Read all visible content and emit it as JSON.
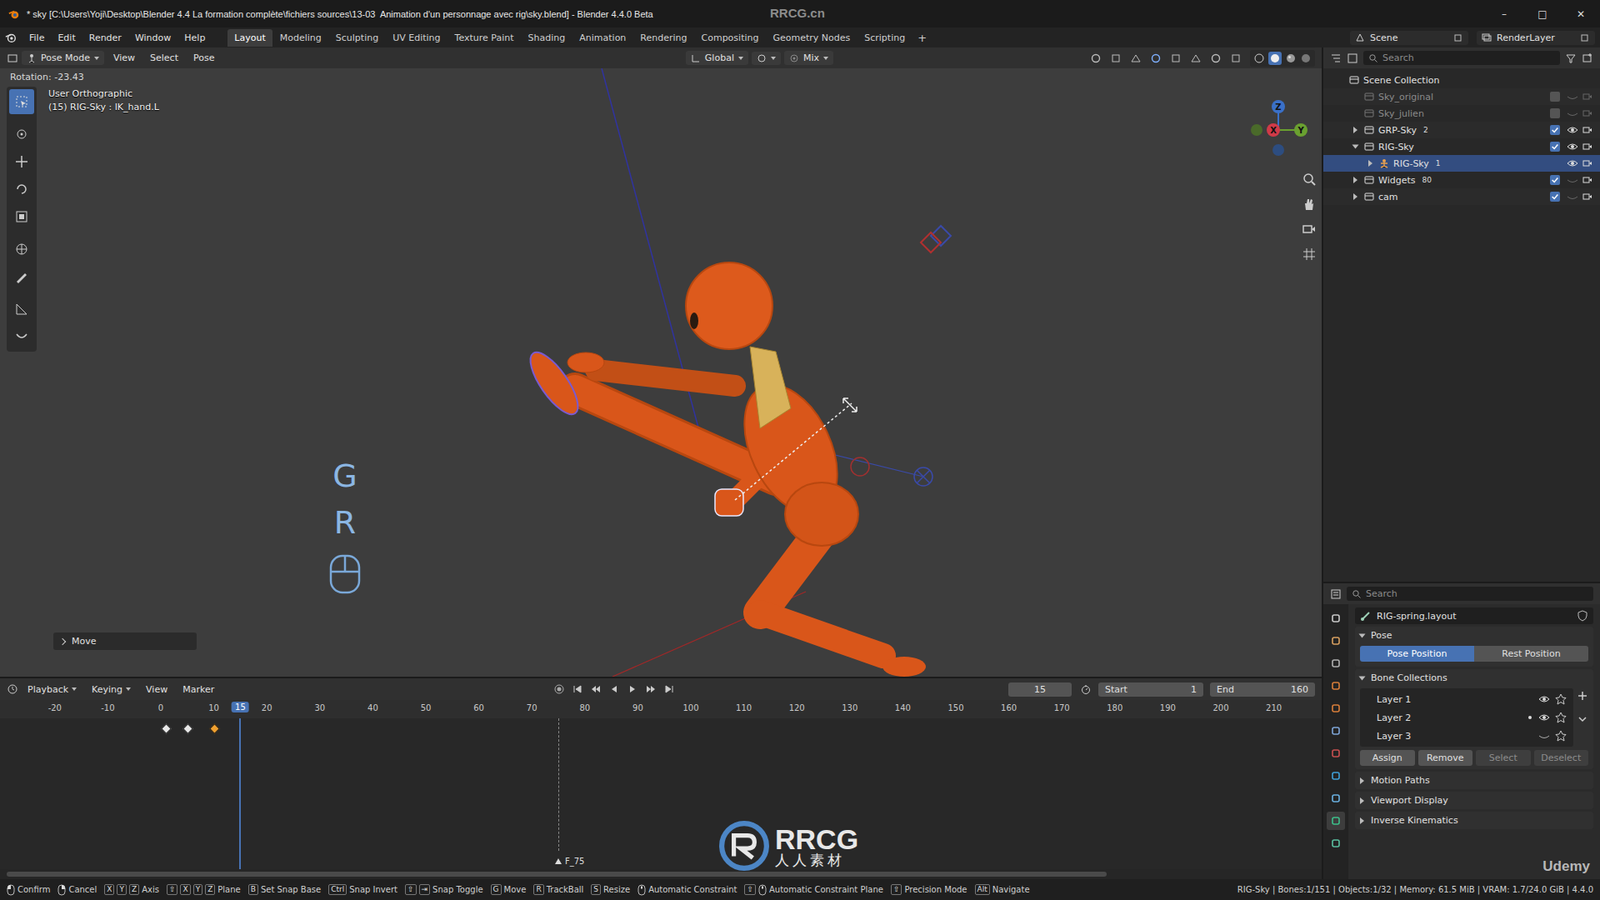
{
  "window": {
    "title": "* sky [C:\\Users\\Yoji\\Desktop\\Blender 4.4 La formation complète\\fichiers sources\\13-03  Animation d'un personnage avec rig\\sky.blend] - Blender 4.4.0 Beta",
    "controls": [
      "–",
      "□",
      "✕"
    ]
  },
  "watermarks": {
    "top": "RRCG.cn",
    "logo": "RRCG",
    "logo_sub": "人人素材",
    "corner": "Udemy"
  },
  "menu": [
    "File",
    "Edit",
    "Render",
    "Window",
    "Help"
  ],
  "workspaces": [
    {
      "label": "Layout",
      "selected": true
    },
    {
      "label": "Modeling",
      "selected": false
    },
    {
      "label": "Sculpting",
      "selected": false
    },
    {
      "label": "UV Editing",
      "selected": false
    },
    {
      "label": "Texture Paint",
      "selected": false
    },
    {
      "label": "Shading",
      "selected": false
    },
    {
      "label": "Animation",
      "selected": false
    },
    {
      "label": "Rendering",
      "selected": false
    },
    {
      "label": "Compositing",
      "selected": false
    },
    {
      "label": "Geometry Nodes",
      "selected": false
    },
    {
      "label": "Scripting",
      "selected": false
    }
  ],
  "workspace_add": "+",
  "scene": "Scene",
  "view_layer": "RenderLayer",
  "viewport": {
    "mode": "Pose Mode",
    "menus": [
      "View",
      "Select",
      "Pose"
    ],
    "orientation": "Global",
    "pivot": "Mix",
    "status": "Rotation: -23.43",
    "view_name": "User Orthographic",
    "active": "(15) RIG-Sky : IK_hand.L",
    "keys": [
      "G",
      "R"
    ],
    "operator": "Move",
    "gizmo": {
      "x": "X",
      "y": "Y",
      "z": "Z"
    }
  },
  "outliner": {
    "search": "Search",
    "items": [
      {
        "name": "Scene Collection",
        "kind": "scene",
        "depth": 0,
        "expandable": false,
        "expanded": false,
        "included": true,
        "visible": true,
        "selected": false,
        "badge": ""
      },
      {
        "name": "Sky_original",
        "kind": "collection",
        "depth": 1,
        "expandable": false,
        "expanded": false,
        "included": false,
        "visible": false,
        "selected": false,
        "badge": ""
      },
      {
        "name": "Sky_julien",
        "kind": "collection",
        "depth": 1,
        "expandable": false,
        "expanded": false,
        "included": false,
        "visible": false,
        "selected": false,
        "badge": ""
      },
      {
        "name": "GRP-Sky",
        "kind": "collection",
        "depth": 1,
        "expandable": true,
        "expanded": false,
        "included": true,
        "visible": true,
        "selected": false,
        "badge": "2"
      },
      {
        "name": "RIG-Sky",
        "kind": "collection",
        "depth": 1,
        "expandable": true,
        "expanded": true,
        "included": true,
        "visible": true,
        "selected": false,
        "badge": ""
      },
      {
        "name": "RIG-Sky",
        "kind": "object",
        "depth": 2,
        "expandable": true,
        "expanded": false,
        "included": true,
        "visible": true,
        "selected": true,
        "badge": "1"
      },
      {
        "name": "Widgets",
        "kind": "collection",
        "depth": 1,
        "expandable": true,
        "expanded": false,
        "included": true,
        "visible": false,
        "selected": false,
        "badge": "80"
      },
      {
        "name": "cam",
        "kind": "collection",
        "depth": 1,
        "expandable": true,
        "expanded": false,
        "included": true,
        "visible": false,
        "selected": false,
        "badge": ""
      }
    ]
  },
  "properties": {
    "search": "Search",
    "tabs": [
      {
        "selected": false
      },
      {
        "selected": false
      },
      {
        "selected": false
      },
      {
        "selected": false
      },
      {
        "selected": false
      },
      {
        "selected": false
      },
      {
        "selected": false
      },
      {
        "selected": false
      },
      {
        "selected": false
      },
      {
        "selected": true
      },
      {
        "selected": false
      }
    ],
    "datablock": "RIG-spring.layout",
    "pose": {
      "title": "Pose",
      "expanded": true,
      "options": [
        {
          "label": "Pose Position",
          "selected": true
        },
        {
          "label": "Rest Position",
          "selected": false
        }
      ]
    },
    "bone_collections": {
      "title": "Bone Collections",
      "expanded": true,
      "layers": [
        {
          "name": "Layer 1",
          "assigned": false,
          "visible": true
        },
        {
          "name": "Layer 2",
          "assigned": true,
          "visible": true
        },
        {
          "name": "Layer 3",
          "assigned": false,
          "visible": false
        }
      ],
      "buttons": [
        {
          "label": "Assign",
          "disabled": false
        },
        {
          "label": "Remove",
          "disabled": false
        },
        {
          "label": "Select",
          "disabled": true
        },
        {
          "label": "Deselect",
          "disabled": true
        }
      ]
    },
    "panels": [
      {
        "title": "Motion Paths",
        "expanded": false
      },
      {
        "title": "Viewport Display",
        "expanded": false
      },
      {
        "title": "Inverse Kinematics",
        "expanded": false
      }
    ]
  },
  "timeline": {
    "menus": [
      "Playback",
      "Keying",
      "View",
      "Marker"
    ],
    "current": "15",
    "current_frame": 15,
    "start_label": "Start",
    "start": "1",
    "end_label": "End",
    "end": "160",
    "ruler": [
      "-20",
      "-10",
      "0",
      "10",
      "20",
      "30",
      "40",
      "50",
      "60",
      "70",
      "80",
      "90",
      "100",
      "110",
      "120",
      "130",
      "140",
      "150",
      "160",
      "170",
      "180",
      "190",
      "200",
      "210"
    ],
    "keyframes": [
      {
        "frame": 1,
        "selected": false
      },
      {
        "frame": 5,
        "selected": false
      },
      {
        "frame": 10,
        "selected": true
      }
    ],
    "markers": [
      {
        "label": "F_75",
        "frame": 75
      }
    ]
  },
  "status_bar": {
    "items": [
      {
        "mouse": "left",
        "keys": [],
        "label": "Confirm"
      },
      {
        "mouse": "right",
        "keys": [],
        "label": "Cancel"
      },
      {
        "mouse": "",
        "keys": [
          "X",
          "Y",
          "Z"
        ],
        "label": "Axis"
      },
      {
        "mouse": "",
        "keys": [
          "⇧",
          "X",
          "Y",
          "Z"
        ],
        "label": "Plane"
      },
      {
        "mouse": "",
        "keys": [
          "B"
        ],
        "label": "Set Snap Base"
      },
      {
        "mouse": "",
        "keys": [
          "Ctrl"
        ],
        "label": "Snap Invert"
      },
      {
        "mouse": "",
        "keys": [
          "⇧",
          "⇥"
        ],
        "label": "Snap Toggle"
      },
      {
        "mouse": "",
        "keys": [
          "G"
        ],
        "label": "Move"
      },
      {
        "mouse": "",
        "keys": [
          "R"
        ],
        "label": "TrackBall"
      },
      {
        "mouse": "",
        "keys": [
          "S"
        ],
        "label": "Resize"
      },
      {
        "mouse": "middle",
        "keys": [],
        "label": "Automatic Constraint"
      },
      {
        "mouse": "middle",
        "keys": [
          "⇧"
        ],
        "label": "Automatic Constraint Plane"
      },
      {
        "mouse": "",
        "keys": [
          "⇧"
        ],
        "label": "Precision Mode"
      },
      {
        "mouse": "",
        "keys": [
          "Alt"
        ],
        "label": "Navigate"
      }
    ],
    "info": "RIG-Sky | Bones:1/151 | Objects:1/32 | Memory: 61.5 MiB | VRAM: 1.7/24.0 GiB | 4.4.0"
  }
}
